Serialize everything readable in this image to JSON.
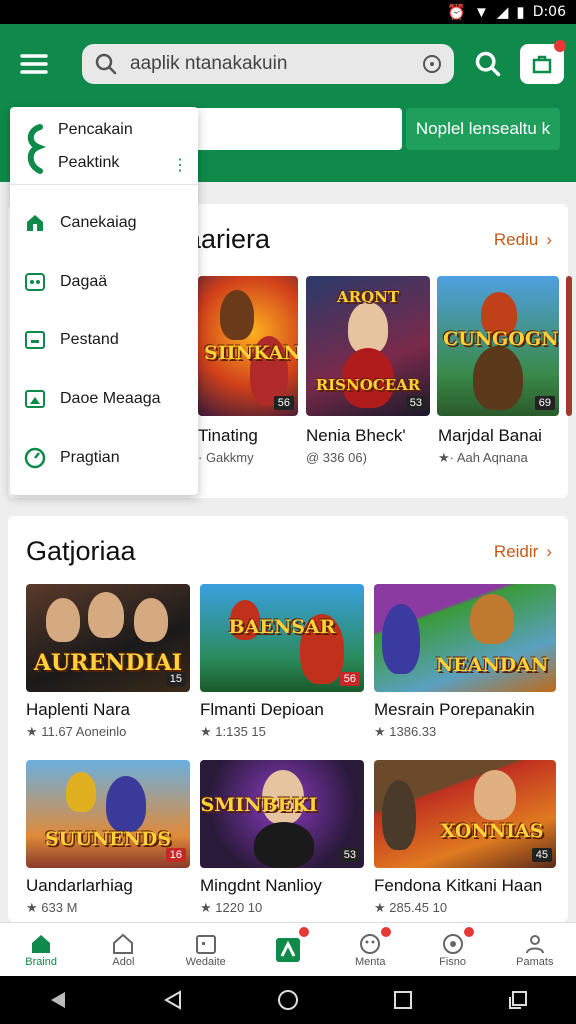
{
  "status": {
    "time": "D:06"
  },
  "header": {
    "search_text": "aaplik ntanakakuin",
    "action_button": "Noplel lensealtu k"
  },
  "drawer": {
    "head_line1": "Pencakain",
    "head_line2": "Peaktink",
    "items": [
      {
        "label": "Canekaiag",
        "icon": "home-icon"
      },
      {
        "label": "Dagaä",
        "icon": "game-icon"
      },
      {
        "label": "Pestand",
        "icon": "folder-icon"
      },
      {
        "label": "Daoe Meaaga",
        "icon": "image-icon"
      },
      {
        "label": "Pragtian",
        "icon": "gauge-icon"
      }
    ]
  },
  "section1": {
    "title": "aariera",
    "more": "Rediu",
    "games": [
      {
        "title": "Tinating",
        "meta": "· Gakkmy",
        "logo": "SIINKAN",
        "badge": "56"
      },
      {
        "title": "Nenia Bheck'",
        "meta": "@ 336 06)",
        "logo": "RISNOCEAR",
        "badge": "53"
      },
      {
        "title": "Marjdal Banai",
        "meta": "★· Aah Aqnana",
        "logo": "CUNGOGNI",
        "badge": "69"
      }
    ]
  },
  "section2": {
    "title": "Gatjoriaa",
    "more": "Reidir",
    "row1": [
      {
        "title": "Haplenti Nara",
        "meta": "★ 11.67 Aoneinlo",
        "logo": "AURENDIAI",
        "badge": "15"
      },
      {
        "title": "Flmanti Depioan",
        "meta": "★ 1:135 15",
        "logo": "BAENSAR",
        "badge": "56"
      },
      {
        "title": "Mesrain Porepanakin",
        "meta": "★ 1386.33",
        "logo": "NEANDAN",
        "badge": ""
      }
    ],
    "row2": [
      {
        "title": "Uandarlarhiag",
        "meta": "★ 633 M",
        "logo": "SUUNENDS",
        "badge": "16"
      },
      {
        "title": "Mingdnt Nanlioy",
        "meta": "★ 1220 10",
        "logo": "SMINBEKI",
        "badge": "53"
      },
      {
        "title": "Fendona Kitkani Haan",
        "meta": "★ 285.45 10",
        "logo": "XONNIAS",
        "badge": "45"
      }
    ]
  },
  "nav": [
    {
      "label": "Braind",
      "icon": "home-icon",
      "active": true
    },
    {
      "label": "Adol",
      "icon": "house-outline-icon"
    },
    {
      "label": "Wedaite",
      "icon": "calendar-icon"
    },
    {
      "label": "",
      "icon": "game-tile-icon"
    },
    {
      "label": "Menta",
      "icon": "emoji-icon"
    },
    {
      "label": "Fisno",
      "icon": "badge-icon"
    },
    {
      "label": "Pamats",
      "icon": "person-icon"
    }
  ],
  "colors": {
    "primary": "#0f8a4a",
    "accent": "#c25a1a"
  }
}
